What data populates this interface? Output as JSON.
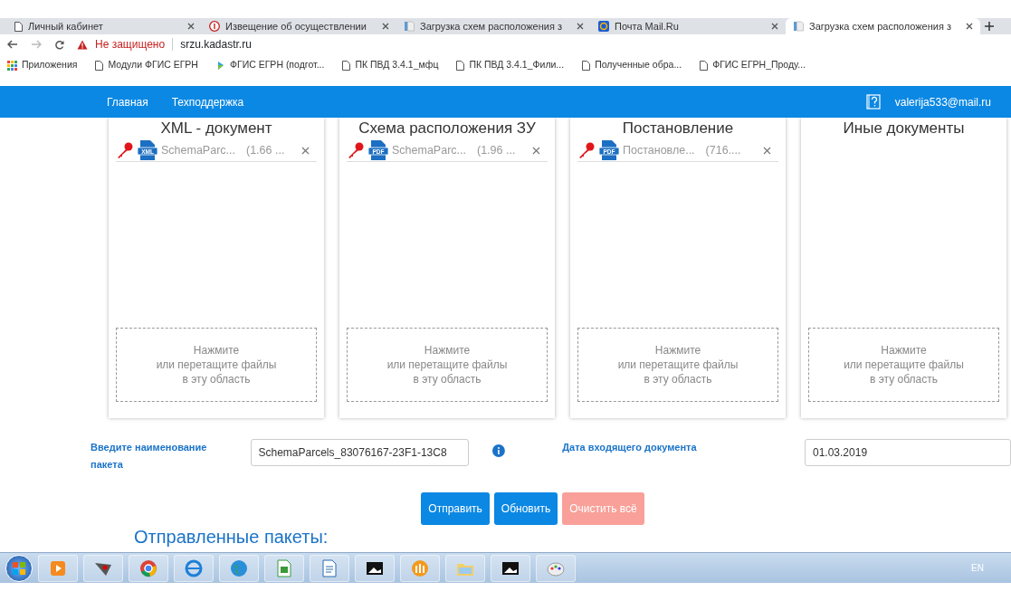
{
  "browser": {
    "tabs": [
      {
        "title": "Личный кабинет",
        "kind": "page",
        "selected": false
      },
      {
        "title": "Извещение об осуществлении",
        "kind": "alert",
        "selected": false
      },
      {
        "title": "Загрузка схем расположения з",
        "kind": "doc",
        "selected": false
      },
      {
        "title": "Почта Mail.Ru",
        "kind": "mail",
        "selected": false
      },
      {
        "title": "Загрузка схем расположения з",
        "kind": "doc",
        "selected": true
      }
    ],
    "address": {
      "security": "Не защищено",
      "url": "srzu.kadastr.ru"
    },
    "bookmarks": [
      {
        "label": "Приложения",
        "kind": "apps"
      },
      {
        "label": "Модули ФГИС ЕГРН",
        "kind": "page"
      },
      {
        "label": "ФГИС ЕГРН (подгот...",
        "kind": "logo"
      },
      {
        "label": "ПК ПВД 3.4.1_мфц",
        "kind": "page"
      },
      {
        "label": "ПК ПВД 3.4.1_Фили...",
        "kind": "page"
      },
      {
        "label": "Полученные обра...",
        "kind": "page"
      },
      {
        "label": "ФГИС ЕГРН_Проду...",
        "kind": "page"
      }
    ]
  },
  "nav": {
    "links": [
      "Главная",
      "Техподдержка"
    ],
    "user_email": "valerija533@mail.ru"
  },
  "panels": [
    {
      "title": "XML - документ",
      "files": [
        {
          "type": "XML",
          "name": "SchemaParc...",
          "size": "(1.66 ..."
        }
      ],
      "dropzone": "Нажмите\nили перетащите файлы\nв эту область"
    },
    {
      "title": "Схема расположения ЗУ",
      "files": [
        {
          "type": "PDF",
          "name": "SchemaParc...",
          "size": "(1.96 ..."
        }
      ],
      "dropzone": "Нажмите\nили перетащите файлы\nв эту область"
    },
    {
      "title": "Постановление",
      "files": [
        {
          "type": "PDF",
          "name": "Постановле...",
          "size": "(716...."
        }
      ],
      "dropzone": "Нажмите\nили перетащите файлы\nв эту область"
    },
    {
      "title": "Иные документы",
      "dropzone": "Нажмите\nили перетащите файлы\nв эту область"
    }
  ],
  "form": {
    "package_label": "Введите наименование пакета",
    "package_value": "SchemaParcels_83076167-23F1-13C8",
    "date_label": "Дата входящего документа",
    "date_value": "01.03.2019"
  },
  "buttons": [
    {
      "label": "Отправить",
      "kind": "primary"
    },
    {
      "label": "Обновить",
      "kind": "primary"
    },
    {
      "label": "Очистить всё",
      "kind": "danger"
    }
  ],
  "sent_title": "Отправленные пакеты:",
  "taskbar": {
    "language": "EN"
  }
}
